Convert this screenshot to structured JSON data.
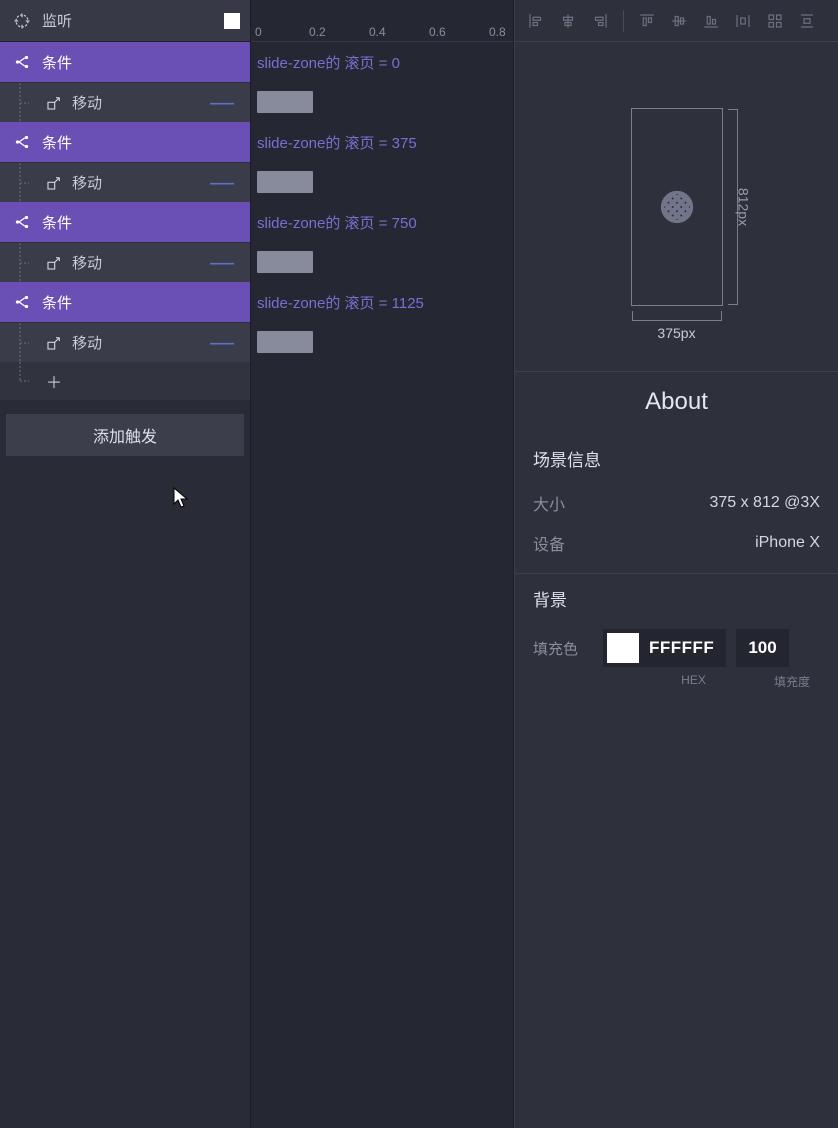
{
  "trigger": {
    "label": "监听"
  },
  "conditions": [
    {
      "label": "条件",
      "text": "slide-zone的 滚页 = 0",
      "action": "移动"
    },
    {
      "label": "条件",
      "text": "slide-zone的 滚页 = 375",
      "action": "移动"
    },
    {
      "label": "条件",
      "text": "slide-zone的 滚页 = 750",
      "action": "移动"
    },
    {
      "label": "条件",
      "text": "slide-zone的 滚页 = 1125",
      "action": "移动"
    }
  ],
  "add_trigger_label": "添加触发",
  "ruler": {
    "ticks": [
      "0",
      "0.2",
      "0.4",
      "0.6",
      "0.8"
    ]
  },
  "preview": {
    "width_label": "375px",
    "height_label": "812px"
  },
  "right": {
    "title": "About",
    "scene_info_label": "场景信息",
    "size_label": "大小",
    "size_value": "375 x 812 @3X",
    "device_label": "设备",
    "device_value": "iPhone X",
    "bg_label": "背景",
    "fill_label": "填充色",
    "hex": "FFFFFF",
    "hex_sublabel": "HEX",
    "opacity": "100",
    "opacity_sublabel": "填充度"
  }
}
